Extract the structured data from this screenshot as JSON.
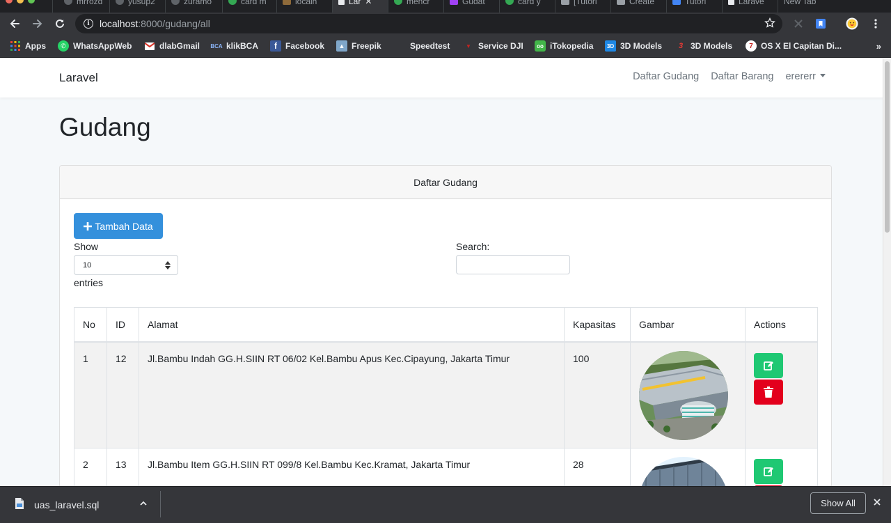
{
  "browser": {
    "tabs": [
      {
        "label": "mrrozd",
        "active": false
      },
      {
        "label": "yusup2",
        "active": false
      },
      {
        "label": "zuramo",
        "active": false
      },
      {
        "label": "card m",
        "active": false
      },
      {
        "label": "localh",
        "active": false
      },
      {
        "label": "Lar",
        "active": true
      },
      {
        "label": "mencr",
        "active": false
      },
      {
        "label": "Gudat",
        "active": false
      },
      {
        "label": "card y",
        "active": false
      },
      {
        "label": "[Tutori",
        "active": false
      },
      {
        "label": "Create",
        "active": false
      },
      {
        "label": "Tutori",
        "active": false
      },
      {
        "label": "Larave",
        "active": false
      },
      {
        "label": "New Tab",
        "active": false
      }
    ],
    "url_host": "localhost",
    "url_path": ":8000/gudang/all",
    "bookmarks": [
      {
        "label": "Apps",
        "icon": "apps-grid-icon"
      },
      {
        "label": "WhatsAppWeb",
        "icon": "whatsapp-icon"
      },
      {
        "label": "dlabGmail",
        "icon": "gmail-icon"
      },
      {
        "label": "klikBCA",
        "icon": "bca-icon"
      },
      {
        "label": "Facebook",
        "icon": "facebook-icon"
      },
      {
        "label": "Freepik",
        "icon": "freepik-icon"
      },
      {
        "label": "Speedtest",
        "icon": "speedtest-icon"
      },
      {
        "label": "Service DJI",
        "icon": "dji-icon"
      },
      {
        "label": "iTokopedia",
        "icon": "tokopedia-icon"
      },
      {
        "label": "3D Models",
        "icon": "3d-models-icon"
      },
      {
        "label": "3D Models",
        "icon": "3d-models-alt-icon"
      },
      {
        "label": "OS X El Capitan Di...",
        "icon": "osx-icon"
      }
    ],
    "bookmarks_overflow": "»"
  },
  "navbar": {
    "brand": "Laravel",
    "links": [
      "Daftar Gudang",
      "Daftar Barang"
    ],
    "user": "erererr"
  },
  "page": {
    "title": "Gudang",
    "card_header": "Daftar Gudang",
    "add_button": "Tambah Data",
    "show_label": "Show",
    "page_length": "10",
    "entries_label": "entries",
    "search_label": "Search:",
    "search_value": ""
  },
  "table": {
    "columns": [
      "No",
      "ID",
      "Alamat",
      "Kapasitas",
      "Gambar",
      "Actions"
    ],
    "rows": [
      {
        "no": "1",
        "id": "12",
        "alamat": "Jl.Bambu Indah GG.H.SIIN RT 06/02 Kel.Bambu Apus Kec.Cipayung, Jakarta Timur",
        "kapasitas": "100"
      },
      {
        "no": "2",
        "id": "13",
        "alamat": "Jl.Bambu Item GG.H.SIIN RT 099/8 Kel.Bambu Kec.Kramat, Jakarta Timur",
        "kapasitas": "28"
      }
    ]
  },
  "download_shelf": {
    "filename": "uas_laravel.sql",
    "show_all": "Show All"
  },
  "colors": {
    "primary": "#3490dc",
    "success": "#1fc873",
    "danger": "#e3001d"
  }
}
